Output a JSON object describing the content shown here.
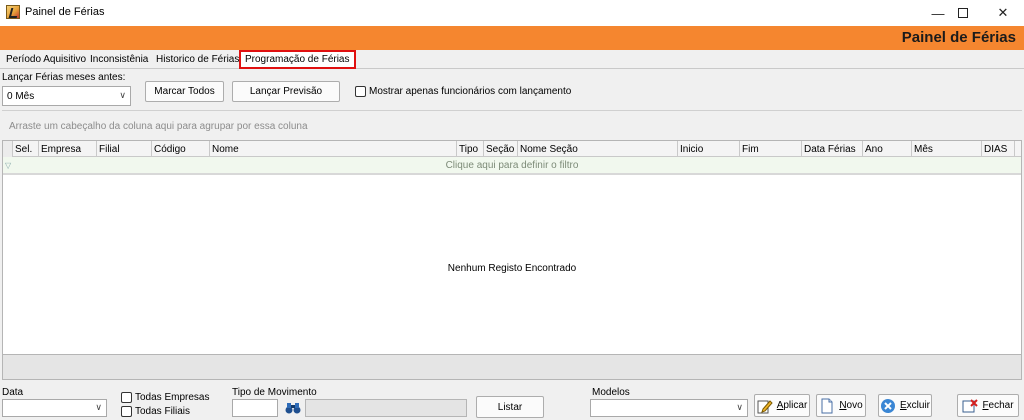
{
  "window": {
    "title": "Painel de Férias"
  },
  "banner": {
    "title": "Painel de Férias"
  },
  "tabs": [
    {
      "label": "Período Aquisitivo"
    },
    {
      "label": "Inconsistênia"
    },
    {
      "label": "Historico de Férias"
    },
    {
      "label": "Programação de Férias"
    }
  ],
  "top_controls": {
    "months_label": "Lançar Férias meses antes:",
    "months_value": "0 Mês",
    "mark_all": "Marcar Todos",
    "launch_forecast": "Lançar Previsão",
    "only_with_launch": "Mostrar apenas funcionários com lançamento"
  },
  "grid": {
    "group_hint": "Arraste um cabeçalho da coluna aqui para agrupar por essa coluna",
    "columns": [
      "Sel.",
      "Empresa",
      "Filial",
      "Código",
      "Nome",
      "Tipo",
      "Seção",
      "Nome Seção",
      "Inicio",
      "Fim",
      "Data Férias",
      "Ano",
      "Mês",
      "DIAS"
    ],
    "filter_hint": "Clique aqui para definir o filtro",
    "empty_message": "Nenhum Registo Encontrado"
  },
  "bottom": {
    "date_label": "Data",
    "date_value": "",
    "all_companies": "Todas Empresas",
    "all_branches": "Todas Filiais",
    "movement_label": "Tipo de Movimento",
    "list_button": "Listar",
    "models_label": "Modelos",
    "apply_prefix": "A",
    "apply_rest": "plicar",
    "new_prefix": "N",
    "new_rest": "ovo",
    "delete_prefix": "E",
    "delete_rest": "xcluir",
    "close_prefix": "F",
    "close_rest": "echar"
  }
}
